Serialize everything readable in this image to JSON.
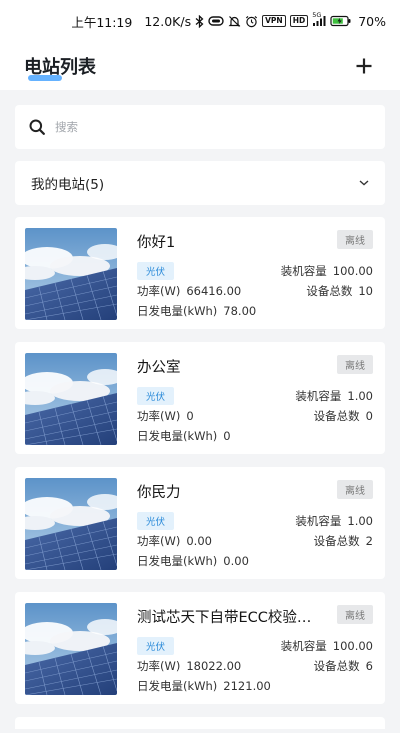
{
  "status_bar": {
    "time": "上午11:19",
    "speed": "12.0K/s",
    "tag_vpn": "VPN",
    "tag_hd": "HD",
    "tag_5g": "5G",
    "battery": "70%"
  },
  "header": {
    "title": "电站列表",
    "add_icon": "plus-icon"
  },
  "search": {
    "placeholder": "搜索",
    "value": ""
  },
  "filter": {
    "label": "我的电站(5)",
    "icon": "chevron-down-icon"
  },
  "labels": {
    "capacity": "装机容量",
    "device_count": "设备总数",
    "power": "功率(W)",
    "daily_energy": "日发电量(kWh)"
  },
  "stations": [
    {
      "name": "你好1",
      "status": "离线",
      "type": "光伏",
      "capacity": "100.00",
      "devices": "10",
      "power": "66416.00",
      "daily": "78.00"
    },
    {
      "name": "办公室",
      "status": "离线",
      "type": "光伏",
      "capacity": "1.00",
      "devices": "0",
      "power": "0",
      "daily": "0"
    },
    {
      "name": "你民力",
      "status": "离线",
      "type": "光伏",
      "capacity": "1.00",
      "devices": "2",
      "power": "0.00",
      "daily": "0.00"
    },
    {
      "name": "测试芯天下自带ECC校验…",
      "status": "离线",
      "type": "光伏",
      "capacity": "100.00",
      "devices": "6",
      "power": "18022.00",
      "daily": "2121.00"
    }
  ],
  "colors": {
    "accent": "#4aa4ff",
    "tag_bg": "#e3f1fc",
    "tag_text": "#2889d8",
    "status_bg": "#e7e8ea"
  }
}
